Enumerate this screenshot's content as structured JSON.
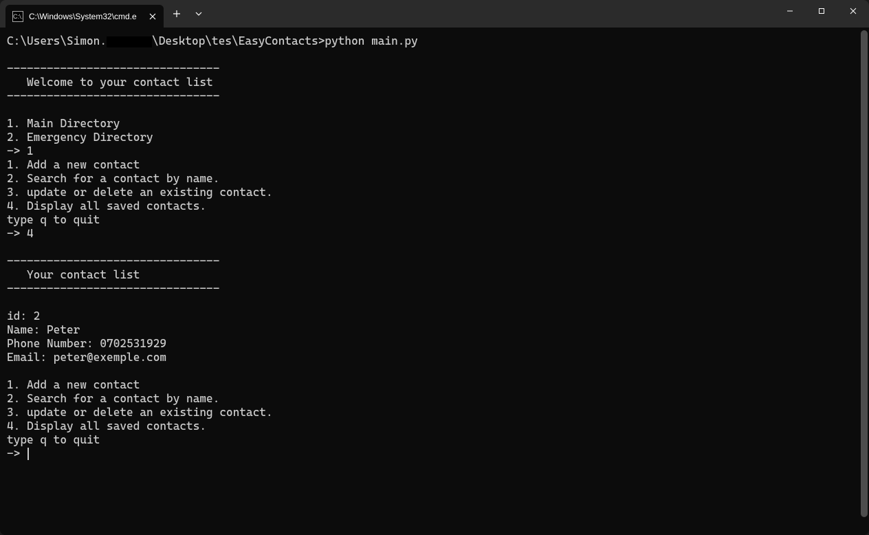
{
  "tab": {
    "title": "C:\\Windows\\System32\\cmd.e",
    "icon_text": "C:\\."
  },
  "prompt": {
    "prefix": "C:\\Users\\Simon.",
    "suffix": "\\Desktop\\tes\\EasyContacts>",
    "command": "python main.py"
  },
  "divider": "--------------------------------",
  "welcome": "   Welcome to your contact list",
  "menu_dir": [
    "1. Main Directory",
    "2. Emergency Directory"
  ],
  "input_arrow": "-> ",
  "input1": "1",
  "menu_main": [
    "1. Add a new contact",
    "2. Search for a contact by name.",
    "3. update or delete an existing contact.",
    "4. Display all saved contacts."
  ],
  "quit_hint": "type q to quit",
  "input2": "4",
  "list_header": "   Your contact list",
  "contact": {
    "id_line": "id: 2",
    "name_line": "Name: Peter",
    "phone_line": "Phone Number: 0702531929",
    "email_line": "Email: peter@exemple.com"
  }
}
